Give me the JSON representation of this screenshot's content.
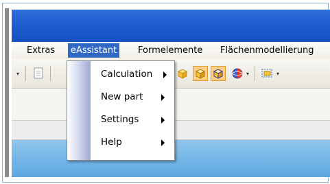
{
  "menubar": {
    "items": [
      {
        "label": "Extras"
      },
      {
        "label": "eAssistant"
      },
      {
        "label": "Formelemente"
      },
      {
        "label": "Flächenmodellierung"
      }
    ]
  },
  "dropdown": {
    "items": [
      {
        "label": "Calculation"
      },
      {
        "label": "New part"
      },
      {
        "label": "Settings"
      },
      {
        "label": "Help"
      }
    ]
  },
  "colors": {
    "titlebar": "#1f5ed0",
    "menu_highlight": "#316ac5",
    "pressed_button": "#ffcf85",
    "viewport": "#5ca7e1"
  }
}
